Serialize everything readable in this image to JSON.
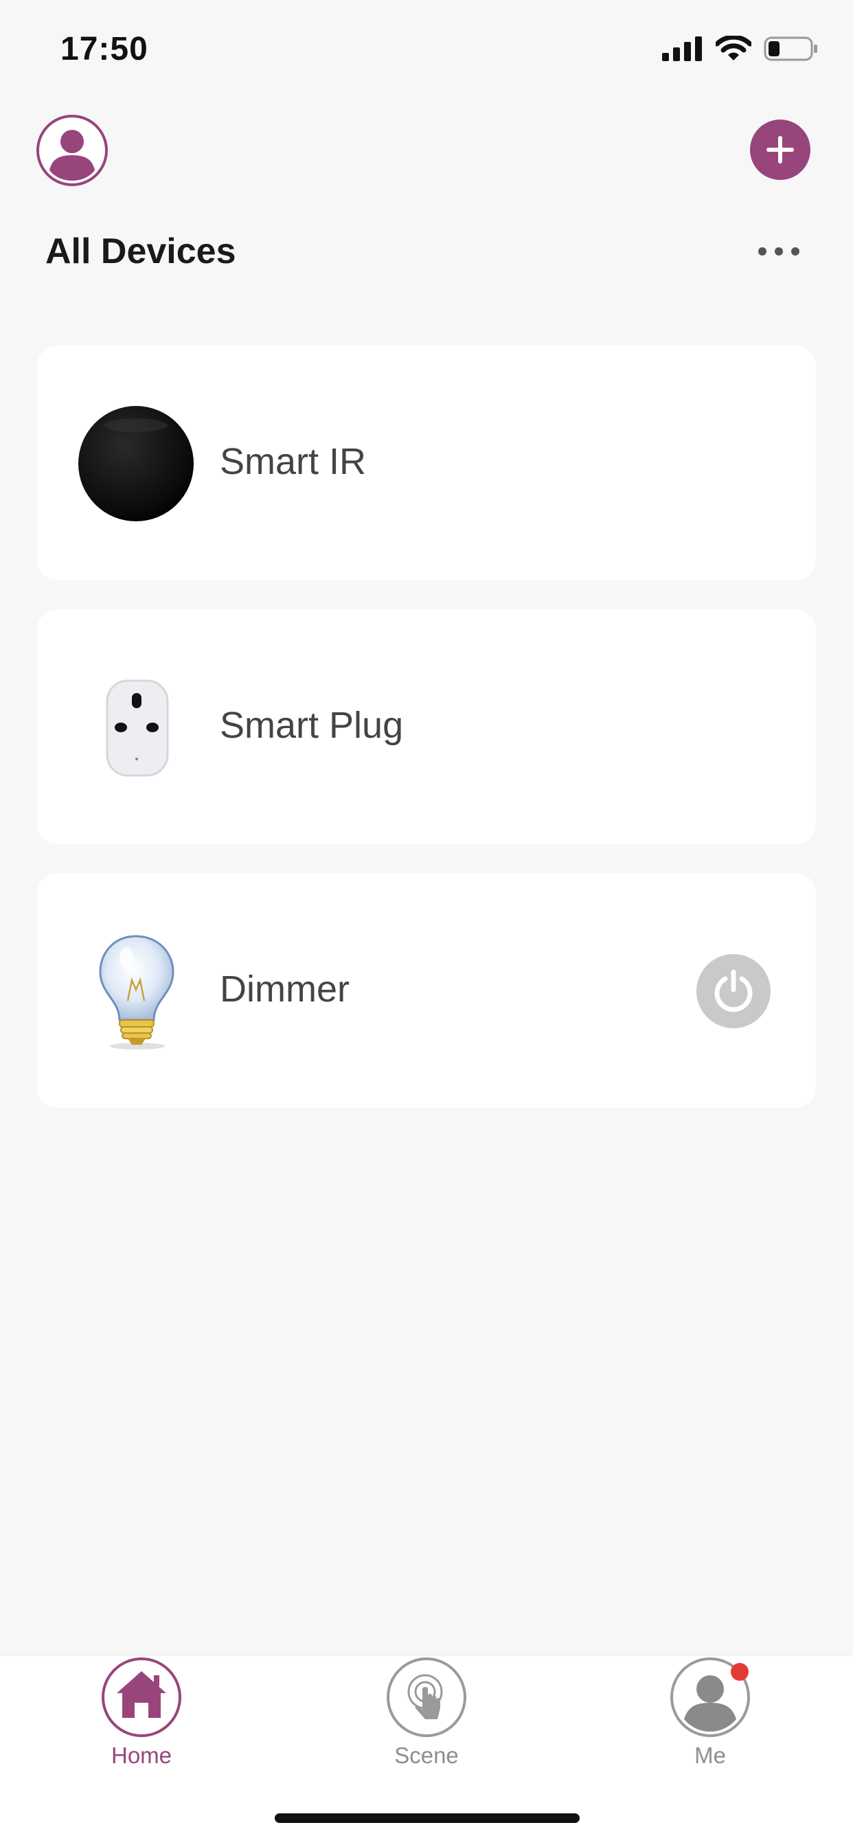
{
  "status_bar": {
    "time": "17:50",
    "icons": [
      "cellular-signal-icon",
      "wifi-icon",
      "battery-icon"
    ]
  },
  "header": {
    "profile_icon": "user-avatar-icon",
    "add_icon": "plus-icon",
    "title": "All Devices",
    "more_icon": "more-horizontal-icon"
  },
  "devices": [
    {
      "name": "Smart IR",
      "icon": "smart-ir-device-icon",
      "has_power_button": false
    },
    {
      "name": "Smart Plug",
      "icon": "smart-plug-device-icon",
      "has_power_button": false
    },
    {
      "name": "Dimmer",
      "icon": "light-bulb-icon",
      "has_power_button": true
    }
  ],
  "tab_bar": {
    "tabs": [
      {
        "label": "Home",
        "icon": "home-icon",
        "active": true
      },
      {
        "label": "Scene",
        "icon": "scene-touch-icon",
        "active": false
      },
      {
        "label": "Me",
        "icon": "me-user-icon",
        "active": false,
        "badge": true
      }
    ]
  },
  "colors": {
    "accent": "#98457c",
    "background": "#f7f7f7",
    "card": "#ffffff",
    "inactive_tab": "#8e8e8e",
    "badge": "#e53935",
    "power_button": "#c9c9c9"
  }
}
